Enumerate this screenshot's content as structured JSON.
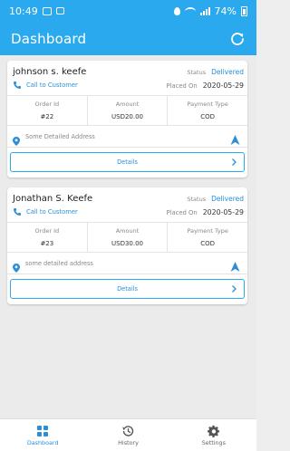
{
  "status_bar": {
    "time": "10:49",
    "battery": "74%"
  },
  "app": {
    "title": "Dashboard",
    "refresh_icon": "refresh-icon"
  },
  "orders": [
    {
      "customer": "johnson s. keefe",
      "status_label": "Status",
      "status_value": "Delivered",
      "call_label": "Call to Customer",
      "placed_label": "Placed On",
      "placed_value": "2020-05-29",
      "columns": [
        {
          "header": "Order Id",
          "value": "#22"
        },
        {
          "header": "Amount",
          "value": "USD20.00"
        },
        {
          "header": "Payment Type",
          "value": "COD"
        }
      ],
      "address": "Some Detailed Address",
      "details_label": "Details"
    },
    {
      "customer": "Jonathan S. Keefe",
      "status_label": "Status",
      "status_value": "Delivered",
      "call_label": "Call to Customer",
      "placed_label": "Placed On",
      "placed_value": "2020-05-29",
      "columns": [
        {
          "header": "Order Id",
          "value": "#23"
        },
        {
          "header": "Amount",
          "value": "USD30.00"
        },
        {
          "header": "Payment Type",
          "value": "COD"
        }
      ],
      "address": "some detailed address",
      "details_label": "Details"
    }
  ],
  "bottom_nav": [
    {
      "label": "Dashboard",
      "icon": "dashboard-icon",
      "active": true
    },
    {
      "label": "History",
      "icon": "history-icon",
      "active": false
    },
    {
      "label": "Settings",
      "icon": "settings-icon",
      "active": false
    }
  ],
  "colors": {
    "primary": "#2aa9ee",
    "link": "#2a8fd6",
    "background": "#ebebeb"
  }
}
